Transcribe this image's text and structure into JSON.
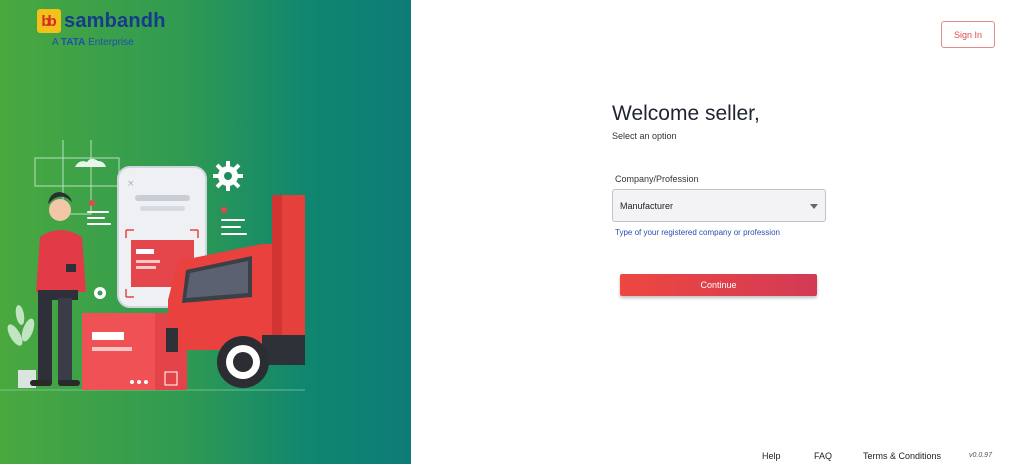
{
  "brand": {
    "badge": "bb",
    "name": "sambandh",
    "tagline_prefix": "A",
    "tagline_brand": "TATA",
    "tagline_suffix": "Enterprise"
  },
  "header": {
    "signin_label": "Sign In"
  },
  "welcome": {
    "title": "Welcome seller,",
    "subtitle": "Select an option"
  },
  "form": {
    "field_label": "Company/Profession",
    "selected_value": "Manufacturer",
    "helper_text": "Type of your registered company or profession",
    "continue_label": "Continue"
  },
  "footer": {
    "links": [
      "Help",
      "FAQ",
      "Terms & Conditions"
    ],
    "version": "v0.0.97"
  },
  "colors": {
    "accent_red": "#e8453c",
    "brand_blue": "#173a8a",
    "panel_green": "#4aa83f",
    "panel_teal": "#0d7c77"
  }
}
